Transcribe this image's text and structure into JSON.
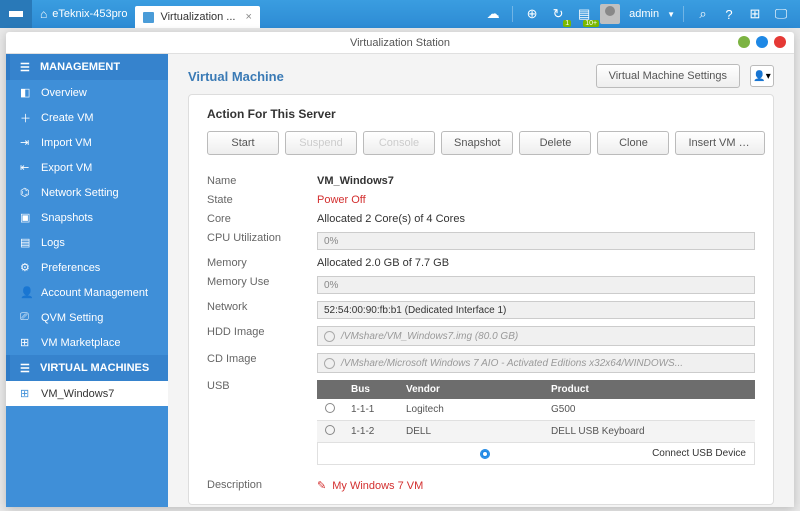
{
  "topbar": {
    "device": "eTeknix-453pro",
    "tab": "Virtualization ...",
    "admin": "admin",
    "badge1": "1",
    "badge2": "10+"
  },
  "window": {
    "title": "Virtualization Station"
  },
  "sidebar": {
    "hdr1": "MANAGEMENT",
    "items1": [
      "Overview",
      "Create VM",
      "Import VM",
      "Export VM",
      "Network Setting",
      "Snapshots",
      "Logs",
      "Preferences",
      "Account Management",
      "QVM Setting",
      "VM Marketplace"
    ],
    "hdr2": "VIRTUAL MACHINES",
    "items2": [
      "VM_Windows7"
    ]
  },
  "content": {
    "title": "Virtual Machine",
    "settings_btn": "Virtual Machine Settings",
    "panel_title": "Action For This Server",
    "actions": [
      "Start",
      "Suspend",
      "Console",
      "Snapshot",
      "Delete",
      "Clone",
      "Insert VM Dr..."
    ],
    "labels": {
      "name": "Name",
      "state": "State",
      "core": "Core",
      "cpu": "CPU Utilization",
      "mem": "Memory",
      "memuse": "Memory Use",
      "net": "Network",
      "hdd": "HDD Image",
      "cd": "CD Image",
      "usb": "USB",
      "desc": "Description"
    },
    "vals": {
      "name": "VM_Windows7",
      "state": "Power Off",
      "core": "Allocated 2 Core(s) of 4 Cores",
      "cpu": "0%",
      "mem": "Allocated 2.0 GB of 7.7 GB",
      "memuse": "0%",
      "net": "52:54:00:90:fb:b1 (Dedicated Interface 1)",
      "hdd": "/VMshare/VM_Windows7.img (80.0 GB)",
      "cd": "/VMshare/Microsoft Windows 7 AIO - Activated Editions x32x64/WINDOWS..."
    },
    "usb": {
      "cols": {
        "bus": "Bus",
        "vendor": "Vendor",
        "product": "Product"
      },
      "rows": [
        {
          "bus": "1-1-1",
          "vendor": "Logitech",
          "product": "G500"
        },
        {
          "bus": "1-1-2",
          "vendor": "DELL",
          "product": "DELL USB Keyboard"
        }
      ],
      "connect": "Connect USB Device"
    },
    "description": "My Windows 7 VM"
  }
}
